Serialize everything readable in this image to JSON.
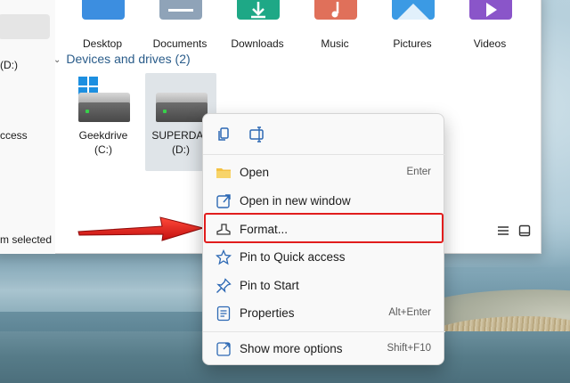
{
  "explorer": {
    "quick_access": {
      "folders": [
        {
          "label": "Desktop",
          "icon": "desktop-folder-icon",
          "color": "#3c8ee0"
        },
        {
          "label": "Documents",
          "icon": "documents-folder-icon",
          "color": "#8fa3b8"
        },
        {
          "label": "Downloads",
          "icon": "downloads-folder-icon",
          "color": "#1ea886"
        },
        {
          "label": "Music",
          "icon": "music-folder-icon",
          "color": "#e0705a"
        },
        {
          "label": "Pictures",
          "icon": "pictures-folder-icon",
          "color": "#3b9ae4"
        },
        {
          "label": "Videos",
          "icon": "videos-folder-icon",
          "color": "#8a55c9"
        }
      ]
    },
    "nav": {
      "drive_d_partial": "(D:)",
      "quick_access_partial": "ccess"
    },
    "section_header": "Devices and drives (2)",
    "drives": [
      {
        "name": "Geekdrive",
        "letter": "(C:)",
        "selected": false
      },
      {
        "name": "SUPERDAV",
        "letter": "(D:)",
        "selected": true
      }
    ],
    "status_bar": "m selected"
  },
  "context_menu": {
    "top_actions": [
      {
        "icon": "copy-icon",
        "tooltip": "Copy"
      },
      {
        "icon": "rename-icon",
        "tooltip": "Rename"
      }
    ],
    "items": [
      {
        "label": "Open",
        "shortcut": "Enter",
        "icon": "folder-open-icon"
      },
      {
        "label": "Open in new window",
        "shortcut": "",
        "icon": "open-new-window-icon"
      },
      {
        "label": "Format...",
        "shortcut": "",
        "icon": "format-drive-icon",
        "highlighted": true
      },
      {
        "label": "Pin to Quick access",
        "shortcut": "",
        "icon": "star-pin-icon"
      },
      {
        "label": "Pin to Start",
        "shortcut": "",
        "icon": "pin-icon"
      },
      {
        "label": "Properties",
        "shortcut": "Alt+Enter",
        "icon": "properties-icon"
      },
      {
        "label": "Show more options",
        "shortcut": "Shift+F10",
        "icon": "more-options-icon"
      }
    ]
  },
  "annotation": {
    "arrow_color": "#e11d1d",
    "highlight_color": "#e11d1d"
  }
}
